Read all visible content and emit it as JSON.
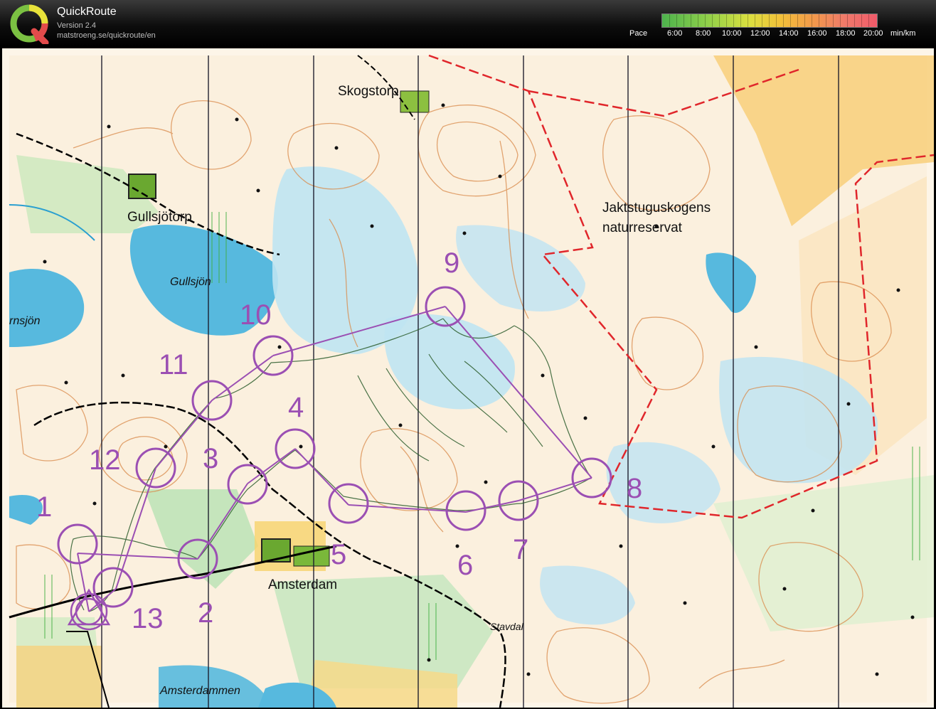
{
  "header": {
    "title": "QuickRoute",
    "version": "Version 2.4",
    "url": "matstroeng.se/quickroute/en",
    "pace_label": "Pace",
    "pace_ticks": [
      "6:00",
      "8:00",
      "10:00",
      "12:00",
      "14:00",
      "16:00",
      "18:00",
      "20:00"
    ],
    "pace_unit": "min/km"
  },
  "map": {
    "places": {
      "skogstorp": "Skogstorp",
      "gullsjotorp": "Gullsjötorp",
      "gullsjon": "Gullsjön",
      "ornsjon": "rnsjön",
      "jakt1": "Jaktstuguskogens",
      "jakt2": "naturreservat",
      "amsterdam": "Amsterdam",
      "stavdal": "Stavdal",
      "amsterdammen": "Amsterdammen"
    },
    "controls": [
      "1",
      "2",
      "3",
      "4",
      "5",
      "6",
      "7",
      "8",
      "9",
      "10",
      "11",
      "12",
      "13"
    ]
  }
}
